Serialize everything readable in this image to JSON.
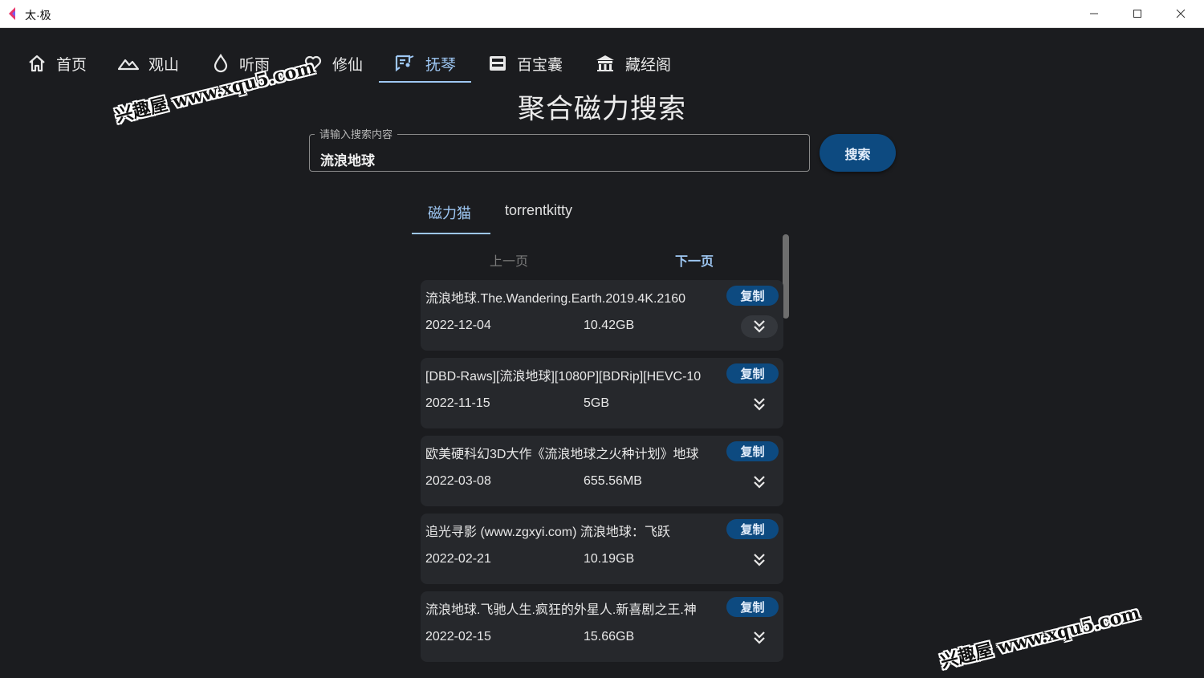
{
  "window": {
    "title": "太·极",
    "colors": {
      "accent": "#9ec7f3",
      "button": "#0d4a80",
      "background": "#1b1c1f",
      "card": "#26282c"
    }
  },
  "nav": {
    "items": [
      {
        "label": "首页",
        "icon": "home-icon"
      },
      {
        "label": "观山",
        "icon": "mountain-icon"
      },
      {
        "label": "听雨",
        "icon": "drop-icon"
      },
      {
        "label": "修仙",
        "icon": "heart-icon"
      },
      {
        "label": "抚琴",
        "icon": "music-list-icon",
        "active": true
      },
      {
        "label": "百宝囊",
        "icon": "inbox-icon"
      },
      {
        "label": "藏经阁",
        "icon": "temple-icon"
      }
    ]
  },
  "page": {
    "title": "聚合磁力搜索"
  },
  "search": {
    "label": "请输入搜索内容",
    "value": "流浪地球",
    "button_label": "搜索"
  },
  "sources": {
    "tabs": [
      {
        "label": "磁力猫",
        "active": true
      },
      {
        "label": "torrentkitty"
      }
    ]
  },
  "pager": {
    "prev_label": "上一页",
    "next_label": "下一页"
  },
  "results": [
    {
      "title": "流浪地球.The.Wandering.Earth.2019.4K.2160",
      "date": "2022-12-04",
      "size": "10.42GB",
      "copy_label": "复制"
    },
    {
      "title": "[DBD-Raws][流浪地球][1080P][BDRip][HEVC-10",
      "date": "2022-11-15",
      "size": "5GB",
      "copy_label": "复制"
    },
    {
      "title": "欧美硬科幻3D大作《流浪地球之火种计划》地球",
      "date": "2022-03-08",
      "size": "655.56MB",
      "copy_label": "复制"
    },
    {
      "title": "追光寻影 (www.zgxyi.com) 流浪地球：飞跃",
      "date": "2022-02-21",
      "size": "10.19GB",
      "copy_label": "复制"
    },
    {
      "title": "流浪地球.飞驰人生.疯狂的外星人.新喜剧之王.神",
      "date": "2022-02-15",
      "size": "15.66GB",
      "copy_label": "复制"
    }
  ],
  "watermarks": [
    "兴趣屋 www.xqu5.com",
    "兴趣屋 www.xqu5.com"
  ]
}
